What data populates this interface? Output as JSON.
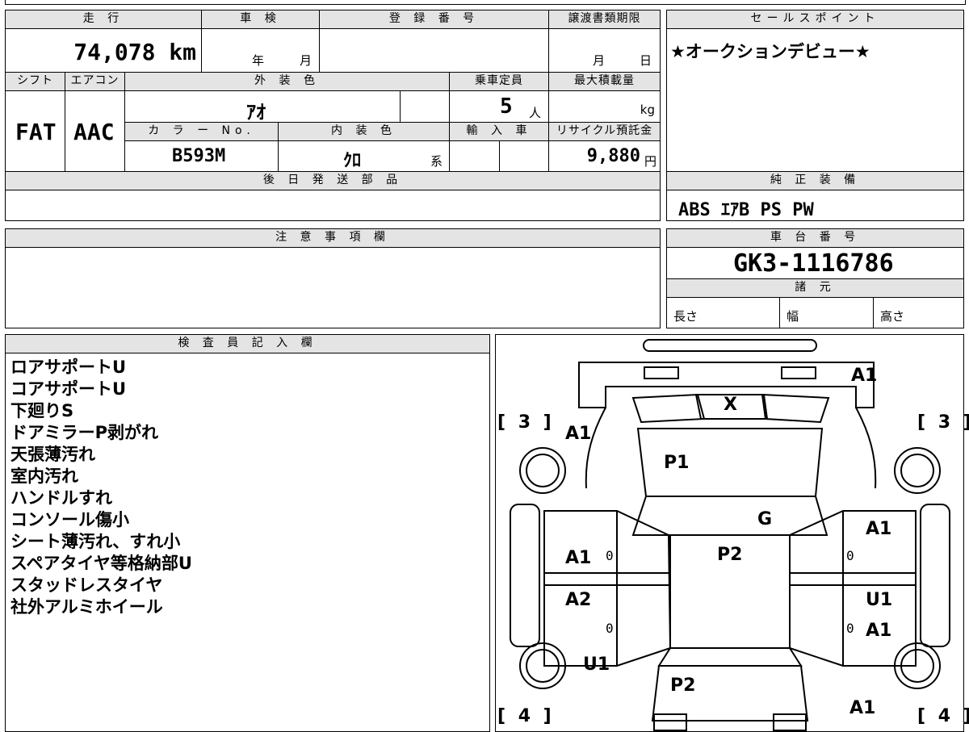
{
  "sheet": {
    "mileage": {
      "label": "走 行",
      "value": "74,078 km"
    },
    "inspection": {
      "label": "車 検",
      "year_unit": "年",
      "month_unit": "月"
    },
    "registration": {
      "label": "登 録 番 号"
    },
    "transfer_deadline": {
      "label": "譲渡書類期限",
      "month_unit": "月",
      "day_unit": "日"
    },
    "shift": {
      "label": "シフト",
      "value": "FAT"
    },
    "aircon": {
      "label": "エアコン",
      "value": "AAC"
    },
    "exterior_color": {
      "label": "外 装 色",
      "value": "ｱｵ"
    },
    "capacity": {
      "label": "乗車定員",
      "value": "5",
      "unit": "人"
    },
    "max_load": {
      "label": "最大積載量",
      "unit": "kg"
    },
    "color_no": {
      "label": "カ ラ ー No.",
      "value": "B593M"
    },
    "interior_color": {
      "label": "内 装 色",
      "value": "ｸﾛ",
      "suffix": "系"
    },
    "import": {
      "label": "輸 入 車"
    },
    "recycle": {
      "label": "リサイクル預託金",
      "value": "9,880",
      "unit": "円"
    },
    "later_parts": {
      "label": "後 日 発 送 部 品"
    },
    "caution": {
      "label": "注 意 事 項 欄"
    },
    "sales_point": {
      "label": "セールスポイント",
      "text": "★オークションデビュー★"
    },
    "equipment": {
      "label": "純 正 装 備",
      "text": "ABS ｴｱB PS PW"
    },
    "chassis": {
      "label": "車 台 番 号",
      "value": "GK3-1116786"
    },
    "specs": {
      "label": "諸 元",
      "length": "長さ",
      "width": "幅",
      "height": "高さ"
    },
    "inspector": {
      "label": "検 査 員 記 入 欄",
      "notes": [
        "ロアサポートU",
        "コアサポートU",
        "下廻りS",
        "ドアミラーP剥がれ",
        "天張薄汚れ",
        "室内汚れ",
        "ハンドルすれ",
        "コンソール傷小",
        "シート薄汚れ、すれ小",
        "スペアタイヤ等格納部U",
        "スタッドレスタイヤ",
        "社外アルミホイール"
      ]
    }
  },
  "diagram": {
    "tire_front_left": "[ 3 ]",
    "tire_front_right": "[ 3 ]",
    "tire_rear_left": "[ 4 ]",
    "tire_rear_right": "[ 4 ]",
    "marks": {
      "bumper_front": "A1",
      "grille": "X",
      "fender_fl": "A1",
      "hood": "P1",
      "windshield": "G",
      "roof": "P2",
      "fender_fr": "A1",
      "door_fl": "A1",
      "door_rl": "A2",
      "door_fr": "U1",
      "door_rr": "A1",
      "quarter_rl": "U1",
      "trunk": "P2",
      "quarter_rr": "A1"
    },
    "zeros": [
      "0",
      "0",
      "0",
      "0"
    ]
  }
}
